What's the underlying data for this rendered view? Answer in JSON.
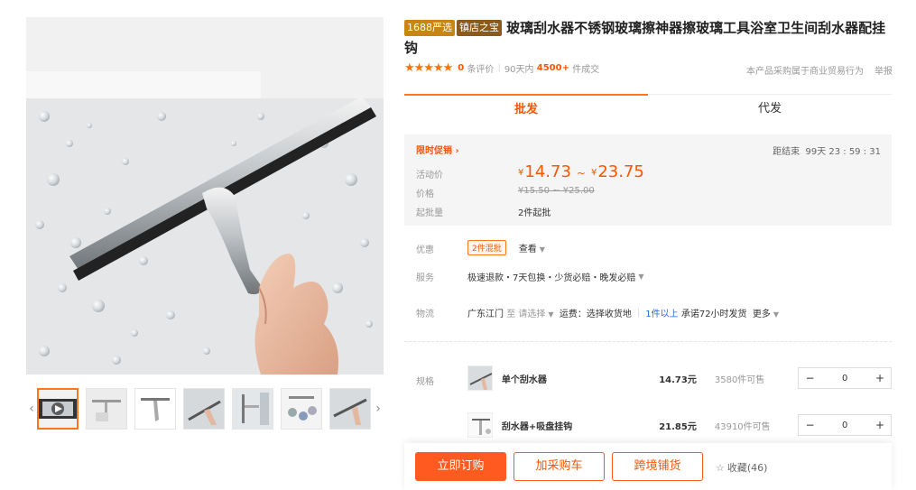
{
  "badges": {
    "brand": "1688严选",
    "shop": "镇店之宝"
  },
  "title": "玻璃刮水器不锈钢玻璃擦神器擦玻璃工具浴室卫生间刮水器配挂钩",
  "rating": {
    "stars": "★★★★★",
    "count": "0",
    "count_label": "条评价",
    "period_label": "90天内",
    "sold": "4500+",
    "sold_label": "件成交"
  },
  "business": {
    "note": "本产品采购属于商业贸易行为",
    "report": "举报"
  },
  "tabs": [
    {
      "label": "批发"
    },
    {
      "label": "代发"
    }
  ],
  "promo": {
    "label": "限时促销",
    "arrow": "›",
    "countdown_label": "距结束",
    "countdown": "99天 23 : 59 : 31",
    "activity_label": "活动价",
    "currency": "¥",
    "price_low": "14.73",
    "price_high": "23.75",
    "tilde": "~",
    "orig_label": "价格",
    "orig_price": "¥15.50 ~ ¥25.00",
    "moq_label": "起批量",
    "moq": "2件起批"
  },
  "discount": {
    "label": "优惠",
    "tag": "2件混批",
    "view": "查看"
  },
  "service": {
    "label": "服务",
    "text": "极速退款・7天包换・少货必赔・晚发必赔"
  },
  "logistics": {
    "label": "物流",
    "origin": "广东江门",
    "to": "至",
    "select": "请选择",
    "freight": "运费：选择收货地",
    "qty": "1件以上",
    "ship": "承诺72小时发货",
    "more": "更多"
  },
  "sku": {
    "label": "规格",
    "items": [
      {
        "name": "单个刮水器",
        "price": "14.73元",
        "stock": "3580件可售",
        "qty": "0"
      },
      {
        "name": "刮水器+吸盘挂钩",
        "price": "21.85元",
        "stock": "43910件可售",
        "qty": "0"
      }
    ],
    "minus": "−",
    "plus": "+"
  },
  "actions": {
    "order": "立即订购",
    "cart": "加采购车",
    "cross": "跨境铺货",
    "fav": "收藏(46)",
    "fav_icon": "☆"
  },
  "gallery": {
    "prev": "‹",
    "next": "›"
  }
}
